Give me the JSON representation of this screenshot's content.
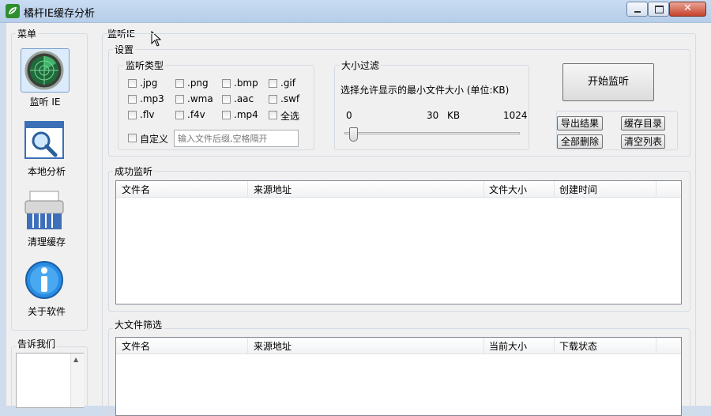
{
  "window": {
    "title": "橘杆IE缓存分析"
  },
  "sidebar": {
    "menu_label": "菜单",
    "items": [
      {
        "label": "监听 IE",
        "icon": "radar-icon"
      },
      {
        "label": "本地分析",
        "icon": "magnifier-window-icon"
      },
      {
        "label": "清理缓存",
        "icon": "shredder-icon"
      },
      {
        "label": "关于软件",
        "icon": "info-icon"
      }
    ],
    "feedback_label": "告诉我们"
  },
  "main": {
    "section_title": "监听IE",
    "settings": {
      "label": "设置",
      "types": {
        "label": "监听类型",
        "options": [
          ".jpg",
          ".png",
          ".bmp",
          ".gif",
          ".mp3",
          ".wma",
          ".aac",
          ".swf",
          ".flv",
          ".f4v",
          ".mp4",
          "全选"
        ],
        "custom_label": "自定义",
        "custom_placeholder": "输入文件后缀,空格隔开"
      },
      "size_filter": {
        "label": "大小过滤",
        "description": "选择允许显示的最小文件大小 (单位:KB)",
        "min": "0",
        "current": "30",
        "unit": "KB",
        "max": "1024",
        "value": 30
      },
      "start_button": "开始监听",
      "actions": [
        "导出结果",
        "缓存目录",
        "全部删除",
        "清空列表"
      ]
    },
    "success": {
      "label": "成功监听",
      "columns": [
        "文件名",
        "来源地址",
        "文件大小",
        "创建时间"
      ]
    },
    "large": {
      "label": "大文件筛选",
      "columns": [
        "文件名",
        "来源地址",
        "当前大小",
        "下载状态"
      ]
    }
  }
}
